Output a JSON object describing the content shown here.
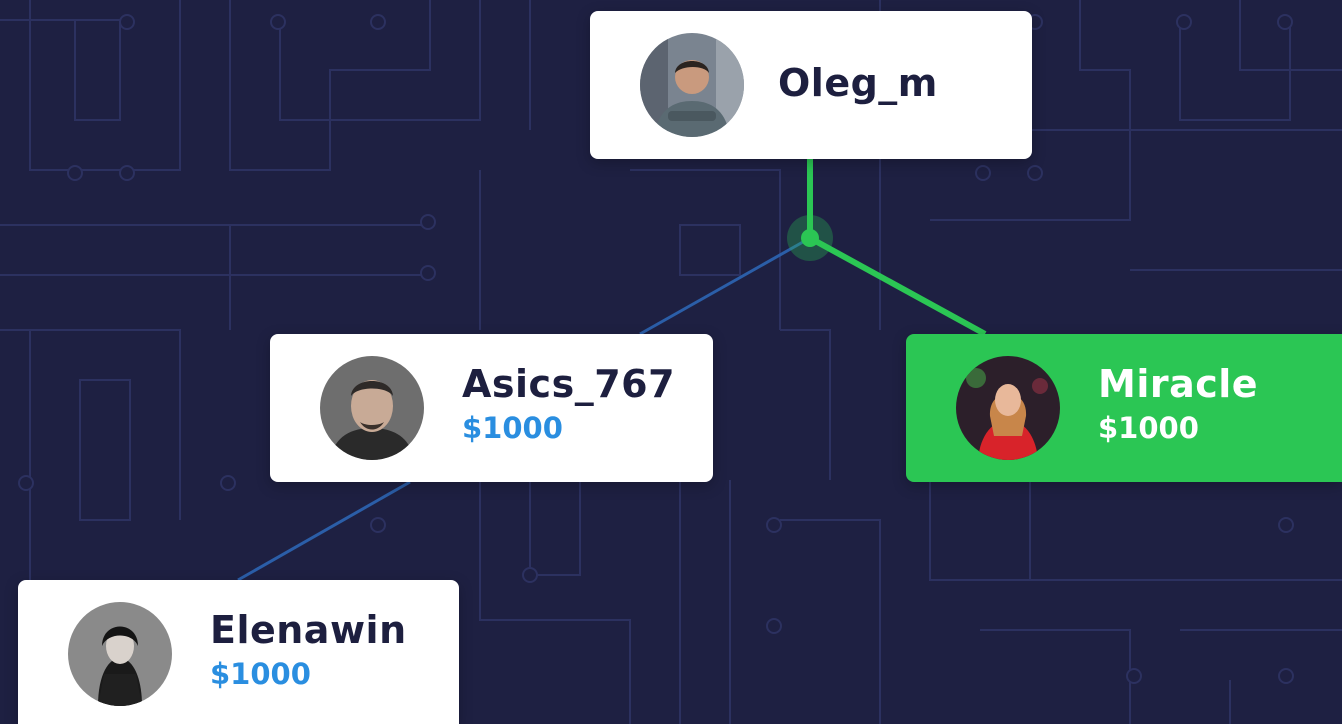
{
  "tree": {
    "root": {
      "name": "Oleg_m",
      "avatar_icon": "user-avatar-man-checked-shirt"
    },
    "children": [
      {
        "name": "Asics_767",
        "amount": "$1000",
        "avatar_icon": "user-avatar-man-beard"
      },
      {
        "name": "Miracle",
        "amount": "$1000",
        "avatar_icon": "user-avatar-woman-red-dress",
        "highlighted": true
      },
      {
        "name": "Elenawin",
        "amount": "$1000",
        "avatar_icon": "user-avatar-woman-dark-hair"
      }
    ]
  },
  "colors": {
    "background": "#1e2042",
    "circuit_lines": "#2c3160",
    "active_branch": "#2bc654",
    "inactive_branch": "#2b5ea8",
    "amount_text": "#2a8ee0",
    "name_text": "#1d1f3f"
  }
}
